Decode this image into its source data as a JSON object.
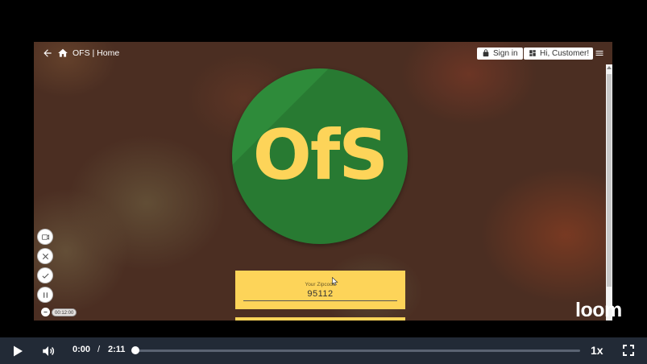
{
  "page": {
    "title": "OFS | Home",
    "sign_in_label": "Sign in",
    "customer_label": "Hi, Customer!",
    "logo_text": "OfS",
    "zip_label": "Your Zipcode",
    "zip_value": "95112"
  },
  "recorder": {
    "time_badge": "00:12:00"
  },
  "branding": {
    "watermark": "loom"
  },
  "player": {
    "current_time": "0:00",
    "separator": "/",
    "duration": "2:11",
    "speed": "1x",
    "progress_fraction": 0
  },
  "colors": {
    "logo_green": "#2e8b3a",
    "logo_yellow": "#fdd459",
    "player_bg": "#222a36"
  }
}
